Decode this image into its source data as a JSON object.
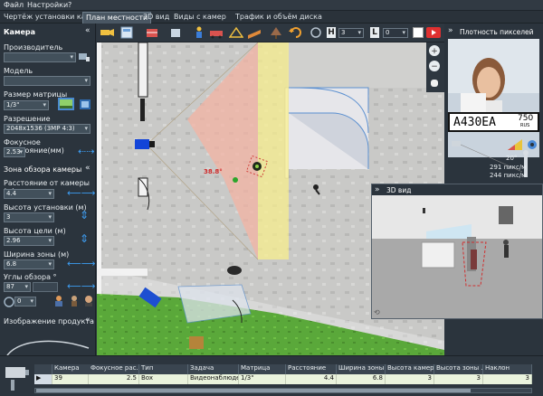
{
  "menu": {
    "file": "Файл",
    "settings": "Настройки",
    "help": "?"
  },
  "tabs": [
    "Чертёж установки камеры",
    "План местности",
    "3D вид",
    "Виды с камер",
    "Трафик и объём диска"
  ],
  "left": {
    "section_camera": "Камера",
    "manufacturer_label": "Производитель",
    "manufacturer_value": "",
    "model_label": "Модель",
    "model_value": "",
    "sensor_label": "Размер матрицы камеры",
    "sensor_value": "1/3\"",
    "resolution_label": "Разрешение",
    "resolution_value": "2048x1536 (3MP 4:3)",
    "focal_label": "Фокусное расстояние(мм)",
    "focal_value": "2.53",
    "section_zone": "Зона обзора камеры",
    "distance_label": "Расстояние от камеры (м)",
    "distance_value": "4.4",
    "height_label": "Высота установки (м)",
    "height_value": "3",
    "target_label": "Высота цели (м)",
    "target_value": "2.96",
    "width_label": "Ширина зоны (м)",
    "width_value": "6.8",
    "angles_label": "Углы обзора °",
    "angle_value": "87",
    "rot_value": "0",
    "section_product": "Изображение продукта"
  },
  "toolbar": {
    "h_value": "3",
    "l_value": "0"
  },
  "plan": {
    "distance_label": "38.8°"
  },
  "right": {
    "title": "Плотность пикселей",
    "plate_text": "А430ЕА",
    "plate_region": "750",
    "plate_country": "RUS",
    "angle": "20°",
    "density1": "291 пикс/м",
    "density2": "244 пикс/м"
  },
  "view3d": {
    "title": "3D вид"
  },
  "table": {
    "headers": [
      "",
      "Камера",
      "Фокусное рас...",
      "Тип",
      "Задача",
      "Матрица",
      "Расстояние",
      "Ширина зоны...",
      "Высота камеры",
      "Высота зоны ...",
      "Наклон"
    ],
    "row": [
      "▶",
      "39",
      "2.5",
      "Box",
      "Видеонаблюде...",
      "1/3\"",
      "4.4",
      "6.8",
      "3",
      "3",
      "3"
    ]
  }
}
